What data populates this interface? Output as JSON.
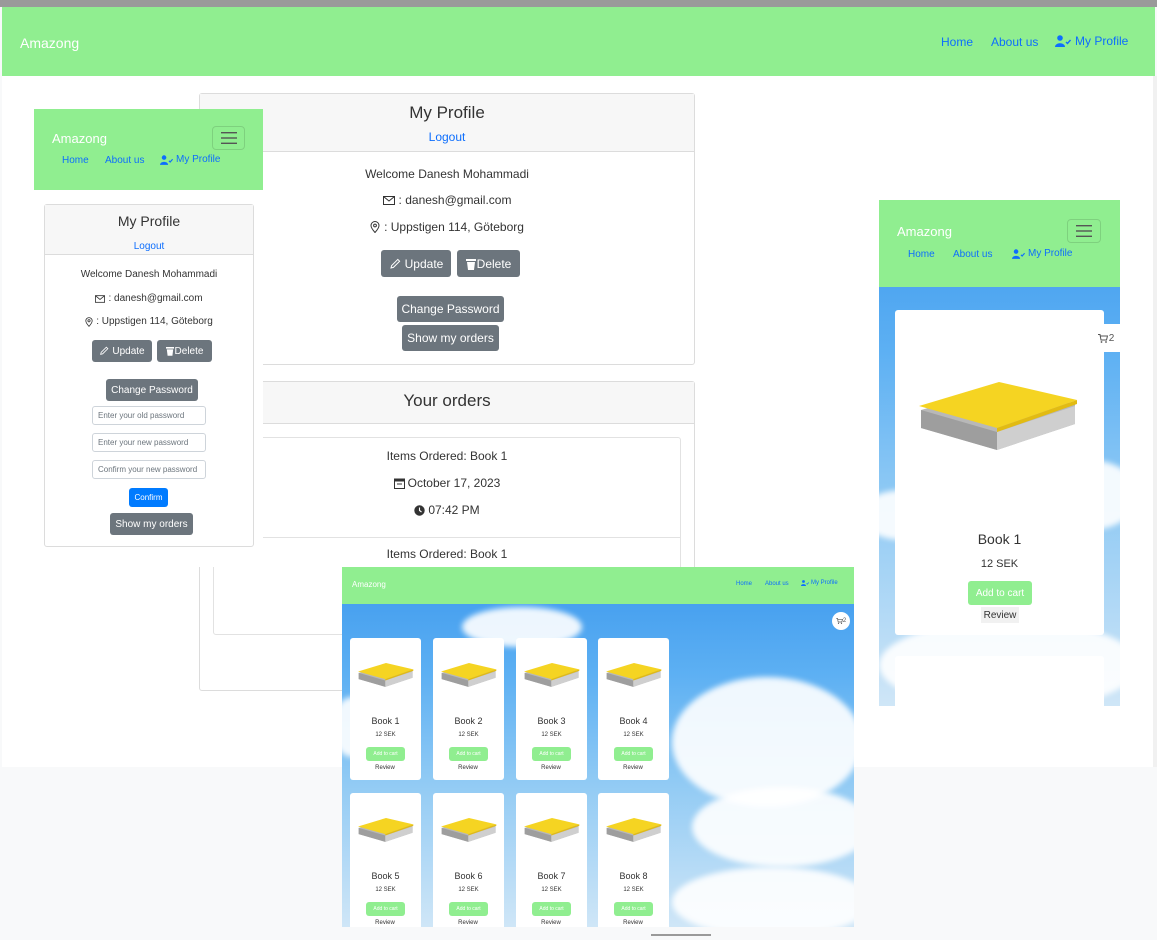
{
  "brand": "Amazong",
  "nav": {
    "home": "Home",
    "about": "About us",
    "profile": "My Profile"
  },
  "profile": {
    "title": "My Profile",
    "logout": "Logout",
    "welcome": "Welcome Danesh Mohammadi",
    "email": ": danesh@gmail.com",
    "address": ": Uppstigen 114, Göteborg",
    "update": "Update",
    "delete": "Delete",
    "change_password": "Change Password",
    "show_orders": "Show my orders",
    "old_pw_placeholder": "Enter your old password",
    "new_pw_placeholder": "Enter your new password",
    "confirm_pw_placeholder": "Confirm your new password",
    "confirm": "Confirm"
  },
  "orders": {
    "title": "Your orders",
    "items": [
      {
        "items": "Items Ordered: Book 1",
        "date": "October 17, 2023",
        "time": "07:42 PM"
      },
      {
        "items": "Items Ordered: Book 1"
      }
    ]
  },
  "cart": {
    "count": "2"
  },
  "product_labels": {
    "add": "Add to cart",
    "review": "Review"
  },
  "products": [
    {
      "name": "Book 1",
      "price": "12 SEK"
    },
    {
      "name": "Book 2",
      "price": "12 SEK"
    },
    {
      "name": "Book 3",
      "price": "12 SEK"
    },
    {
      "name": "Book 4",
      "price": "12 SEK"
    },
    {
      "name": "Book 5",
      "price": "12 SEK"
    },
    {
      "name": "Book 6",
      "price": "12 SEK"
    },
    {
      "name": "Book 7",
      "price": "12 SEK"
    },
    {
      "name": "Book 8",
      "price": "12 SEK"
    }
  ],
  "colors": {
    "navbar": "#90ee90",
    "link": "#0d6efd",
    "secondary": "#6c757d",
    "primary": "#007bff",
    "book_cover": "#f5d422"
  }
}
